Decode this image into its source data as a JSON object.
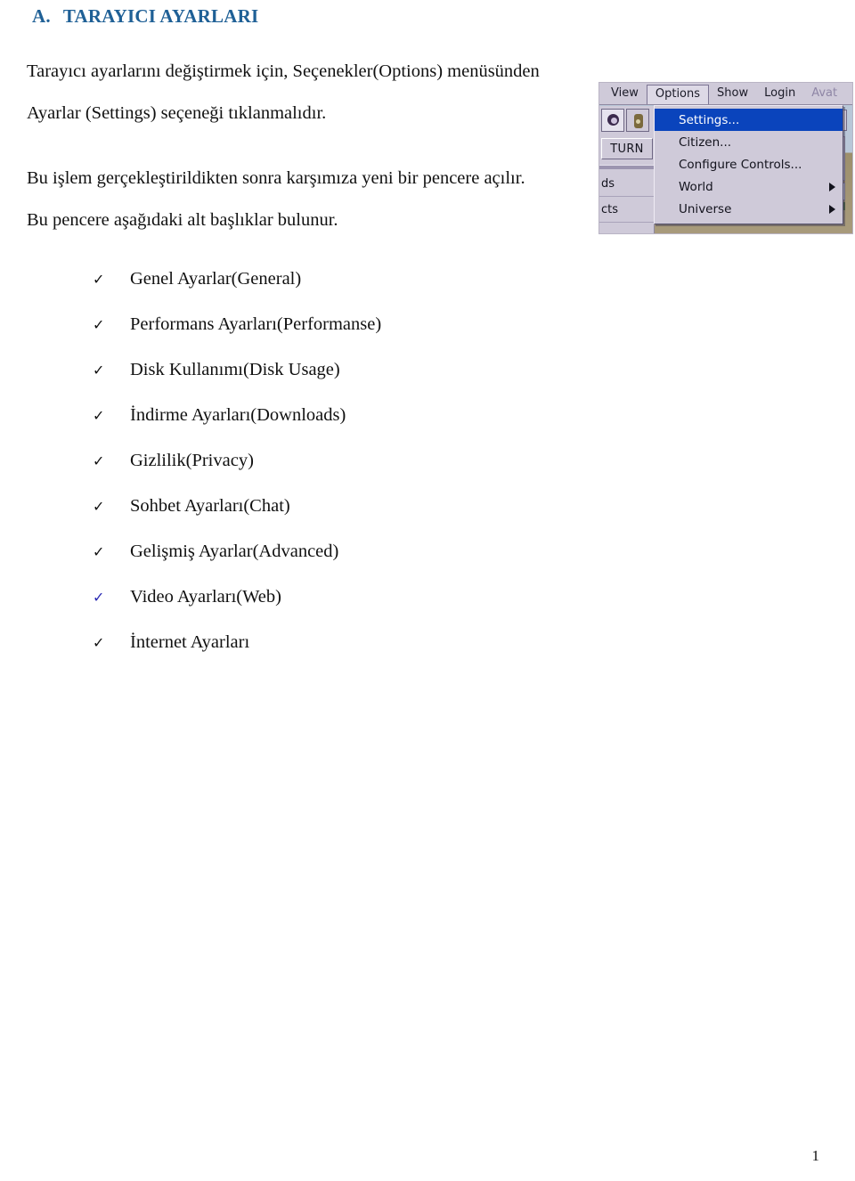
{
  "document": {
    "heading": {
      "label": "A.",
      "title": "TARAYICI AYARLARI",
      "color": "#1f6096"
    },
    "paragraphs": [
      {
        "id": "para-one",
        "lines": [
          "Tarayıcı ayarlarını değiştirmek için, Seçenekler(Options) menüsünden",
          "Ayarlar (Settings) seçeneği tıklanmalıdır."
        ]
      },
      {
        "id": "para-two",
        "lines": [
          "Bu işlem gerçekleştirildikten sonra karşımıza yeni bir pencere açılır.",
          "Bu pencere aşağıdaki alt başlıklar bulunur."
        ]
      }
    ],
    "check_list": {
      "marker": "✓",
      "items": [
        {
          "text": "Genel Ayarlar(General)",
          "accent": "black"
        },
        {
          "text": "Performans Ayarları(Performanse)",
          "accent": "black"
        },
        {
          "text": "Disk Kullanımı(Disk Usage)",
          "accent": "black"
        },
        {
          "text": "İndirme Ayarları(Downloads)",
          "accent": "black"
        },
        {
          "text": "Gizlilik(Privacy)",
          "accent": "black"
        },
        {
          "text": "Sohbet Ayarları(Chat)",
          "accent": "black"
        },
        {
          "text": "Gelişmiş Ayarlar(Advanced)",
          "accent": "black"
        },
        {
          "text": "Video Ayarları(Web)",
          "accent": "blue"
        },
        {
          "text": "İnternet Ayarları",
          "accent": "black"
        }
      ]
    },
    "page_number": "1"
  },
  "screenshot": {
    "menubar": {
      "items": [
        {
          "label": "View",
          "state": "normal"
        },
        {
          "label": "Options",
          "state": "open"
        },
        {
          "label": "Show",
          "state": "normal"
        },
        {
          "label": "Login",
          "state": "normal"
        },
        {
          "label": "Avat",
          "state": "dim"
        }
      ]
    },
    "toolbar": {
      "turn_label": "TURN",
      "partial_labels": [
        "ds",
        "cts"
      ]
    },
    "dropdown": {
      "items": [
        {
          "label": "Settings...",
          "state": "highlighted",
          "submenu": false
        },
        {
          "label": "Citizen...",
          "state": "normal",
          "submenu": false
        },
        {
          "label": "Configure Controls...",
          "state": "normal",
          "submenu": false
        },
        {
          "label": "World",
          "state": "normal",
          "submenu": true
        },
        {
          "label": "Universe",
          "state": "normal",
          "submenu": true
        }
      ],
      "highlight_color": "#0a44bc",
      "background_color": "#cfcad9"
    }
  }
}
